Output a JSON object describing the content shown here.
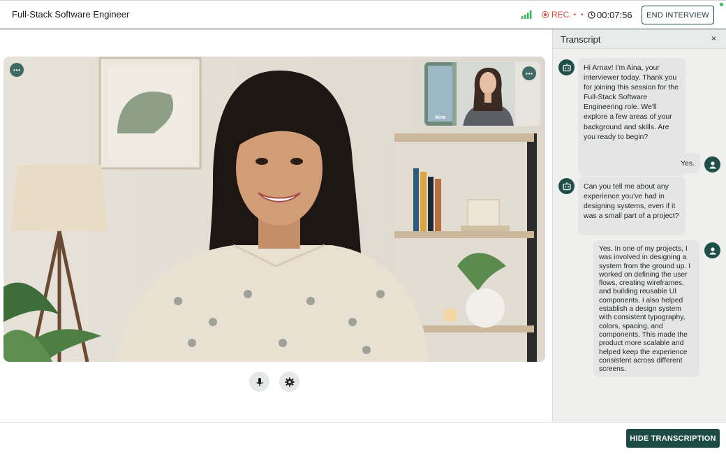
{
  "header": {
    "title": "Full-Stack Software Engineer",
    "signal_icon": "signal-bars-icon",
    "rec_label": "REC.",
    "rec_trail": "• •",
    "timer": "00:07:56",
    "end_button": "END INTERVIEW"
  },
  "colors": {
    "accent": "#1d4a45",
    "rec": "#d9473f",
    "signal": "#2ebd59"
  },
  "pip": {
    "label": "Aina"
  },
  "transcript": {
    "title": "Transcript",
    "close": "×",
    "messages": [
      {
        "role": "interviewer",
        "text": "Hi Arnav! I'm Aina, your interviewer today. Thank you for joining this session for the Full-Stack Software Engineering role. We'll explore a few areas of your background and skills. Are you ready to begin?"
      },
      {
        "role": "candidate",
        "text": "Yes."
      },
      {
        "role": "interviewer",
        "text": "Can you tell me about any experience you've had in designing systems, even if it was a small part of a project?"
      },
      {
        "role": "candidate",
        "text": "Yes. In one of my projects, I was involved in designing a system from the ground up. I worked on defining the user flows, creating wireframes, and building reusable UI components. I also helped establish a design system with consistent typography, colors, spacing, and components. This made the product more scalable and helped keep the experience consistent across different screens."
      }
    ]
  },
  "footer": {
    "hide_button": "HIDE TRANSCRIPTION"
  }
}
